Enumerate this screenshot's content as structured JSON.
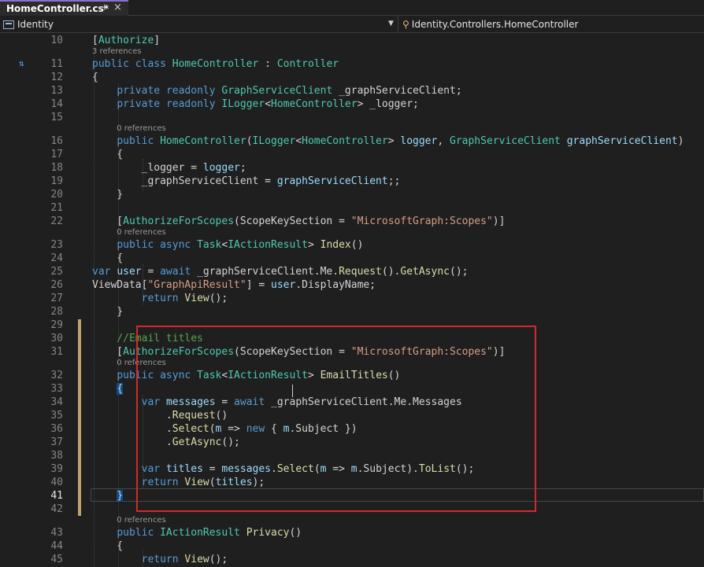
{
  "tab": {
    "label": "HomeController.cs*",
    "pin_icon": "pin-icon",
    "close_icon": "close-icon"
  },
  "nav": {
    "project": "Identity",
    "class_path": "Identity.Controllers.HomeController"
  },
  "colors": {
    "keyword": "#569cd6",
    "type": "#4ec9b0",
    "method": "#dcdcaa",
    "variable": "#9cdcfe",
    "string": "#d69d85",
    "comment": "#57a64a",
    "highlight_box": "#d12a2a"
  },
  "lines": [
    {
      "n": "10",
      "t": "[Authorize]"
    },
    {
      "n": "11",
      "refs": "3 references",
      "t": "public class HomeController : Controller"
    },
    {
      "n": "12",
      "t": "{"
    },
    {
      "n": "13",
      "t": "    private readonly GraphServiceClient _graphServiceClient;"
    },
    {
      "n": "14",
      "t": "    private readonly ILogger<HomeController> _logger;"
    },
    {
      "n": "15",
      "t": ""
    },
    {
      "n": "16",
      "refs": "0 references",
      "t": "    public HomeController(ILogger<HomeController> logger, GraphServiceClient graphServiceClient)"
    },
    {
      "n": "17",
      "t": "    {"
    },
    {
      "n": "18",
      "t": "        _logger = logger;"
    },
    {
      "n": "19",
      "t": "        _graphServiceClient = graphServiceClient;;"
    },
    {
      "n": "20",
      "t": "    }"
    },
    {
      "n": "21",
      "t": ""
    },
    {
      "n": "22",
      "t": "    [AuthorizeForScopes(ScopeKeySection = \"MicrosoftGraph:Scopes\")]"
    },
    {
      "n": "23",
      "refs": "0 references",
      "t": "    public async Task<IActionResult> Index()"
    },
    {
      "n": "24",
      "t": "    {"
    },
    {
      "n": "25",
      "t": "var user = await _graphServiceClient.Me.Request().GetAsync();"
    },
    {
      "n": "26",
      "t": "ViewData[\"GraphApiResult\"] = user.DisplayName;"
    },
    {
      "n": "27",
      "t": "        return View();"
    },
    {
      "n": "28",
      "t": "    }"
    },
    {
      "n": "29",
      "t": ""
    },
    {
      "n": "30",
      "t": "    //Email titles"
    },
    {
      "n": "31",
      "t": "    [AuthorizeForScopes(ScopeKeySection = \"MicrosoftGraph:Scopes\")]"
    },
    {
      "n": "32",
      "refs": "0 references",
      "t": "    public async Task<IActionResult> EmailTitles()"
    },
    {
      "n": "33",
      "t": "    {"
    },
    {
      "n": "34",
      "t": "        var messages = await _graphServiceClient.Me.Messages"
    },
    {
      "n": "35",
      "t": "            .Request()"
    },
    {
      "n": "36",
      "t": "            .Select(m => new { m.Subject })"
    },
    {
      "n": "37",
      "t": "            .GetAsync();"
    },
    {
      "n": "38",
      "t": ""
    },
    {
      "n": "39",
      "t": "        var titles = messages.Select(m => m.Subject).ToList();"
    },
    {
      "n": "40",
      "t": "        return View(titles);"
    },
    {
      "n": "41",
      "t": "    }"
    },
    {
      "n": "42",
      "t": ""
    },
    {
      "n": "43",
      "refs": "0 references",
      "t": "    public IActionResult Privacy()"
    },
    {
      "n": "44",
      "t": "    {"
    },
    {
      "n": "45",
      "t": "        return View();"
    }
  ]
}
